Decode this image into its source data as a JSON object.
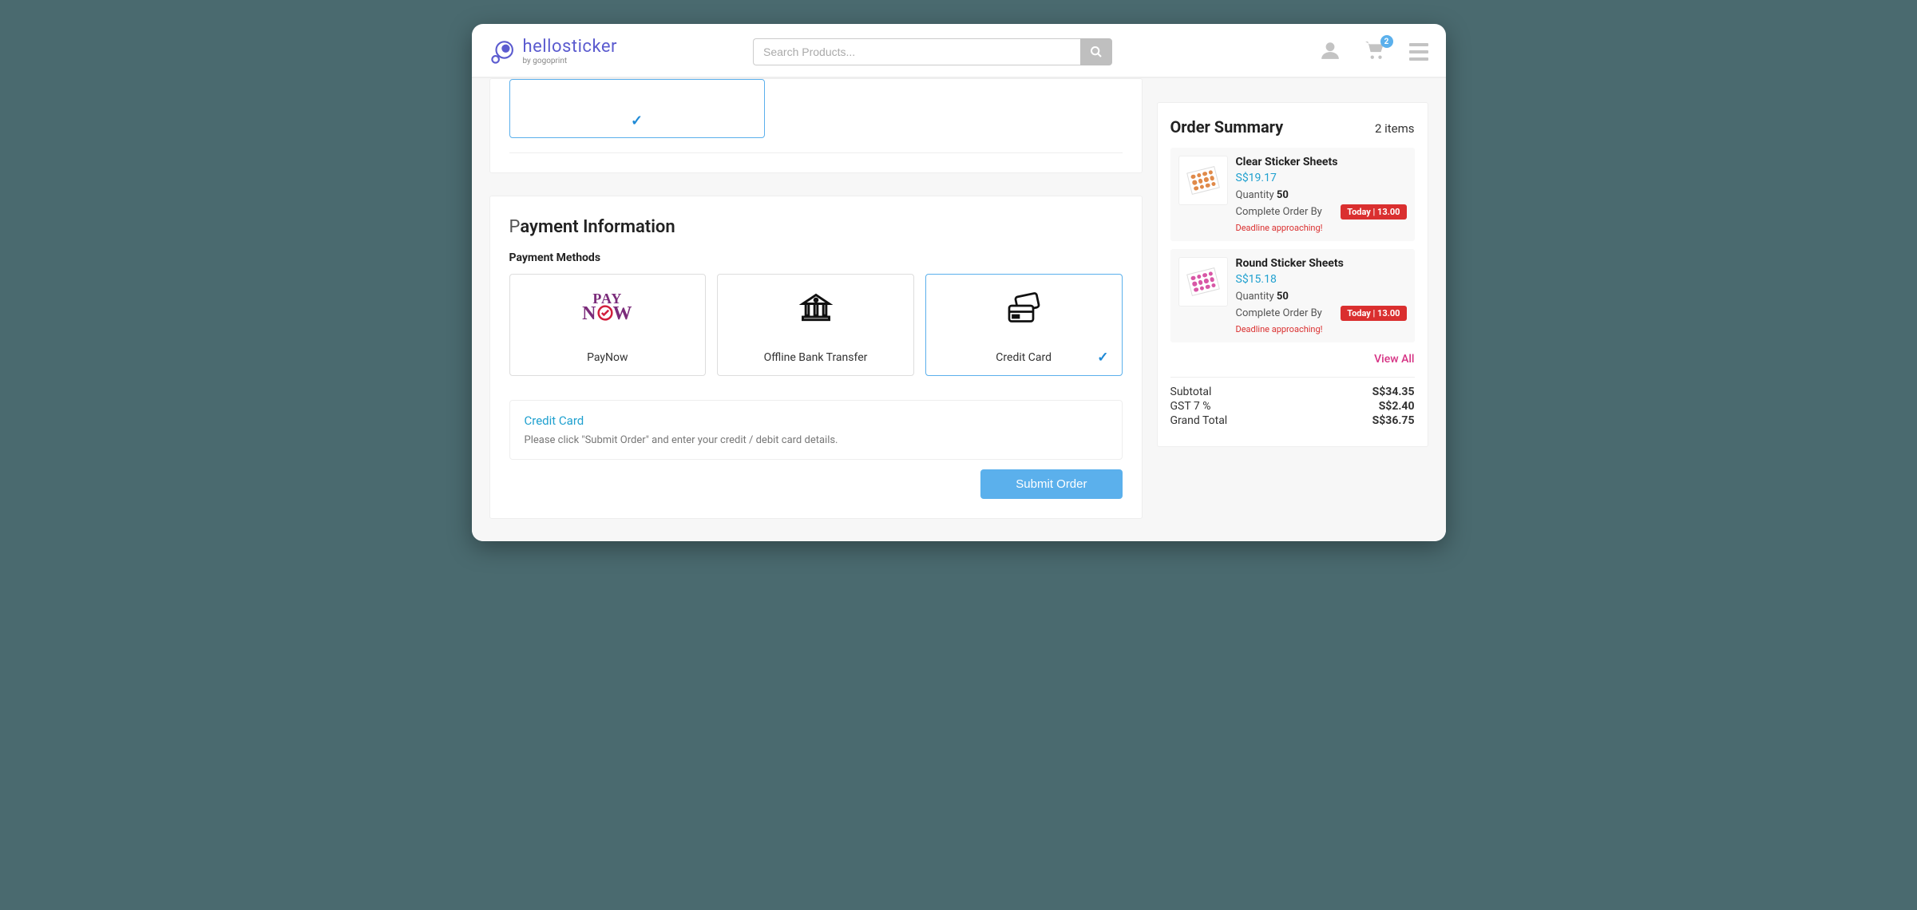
{
  "header": {
    "brand": "hellosticker",
    "subbrand": "by gogoprint",
    "search_placeholder": "Search Products...",
    "cart_count": "2"
  },
  "payment": {
    "title_thin": "P",
    "title_bold": "ayment Information",
    "methods_label": "Payment Methods",
    "options": [
      {
        "label": "PayNow"
      },
      {
        "label": "Offline Bank Transfer"
      },
      {
        "label": "Credit Card"
      }
    ],
    "info_title": "Credit Card",
    "info_body": "Please click \"Submit Order\" and enter your credit / debit card details.",
    "submit_label": "Submit Order"
  },
  "summary": {
    "title": "Order Summary",
    "count": "2 items",
    "items": [
      {
        "name": "Clear Sticker Sheets",
        "price": "S$19.17",
        "qty_label": "Quantity",
        "qty": "50",
        "complete_label": "Complete Order By",
        "badge": "Today | 13.00",
        "deadline": "Deadline approaching!",
        "dot": "#e08a4a"
      },
      {
        "name": "Round Sticker Sheets",
        "price": "S$15.18",
        "qty_label": "Quantity",
        "qty": "50",
        "complete_label": "Complete Order By",
        "badge": "Today | 13.00",
        "deadline": "Deadline approaching!",
        "dot": "#d857a6"
      }
    ],
    "view_all": "View All",
    "subtotal_label": "Subtotal",
    "subtotal": "S$34.35",
    "gst_label": "GST 7 %",
    "gst": "S$2.40",
    "grand_label": "Grand Total",
    "grand": "S$36.75"
  }
}
